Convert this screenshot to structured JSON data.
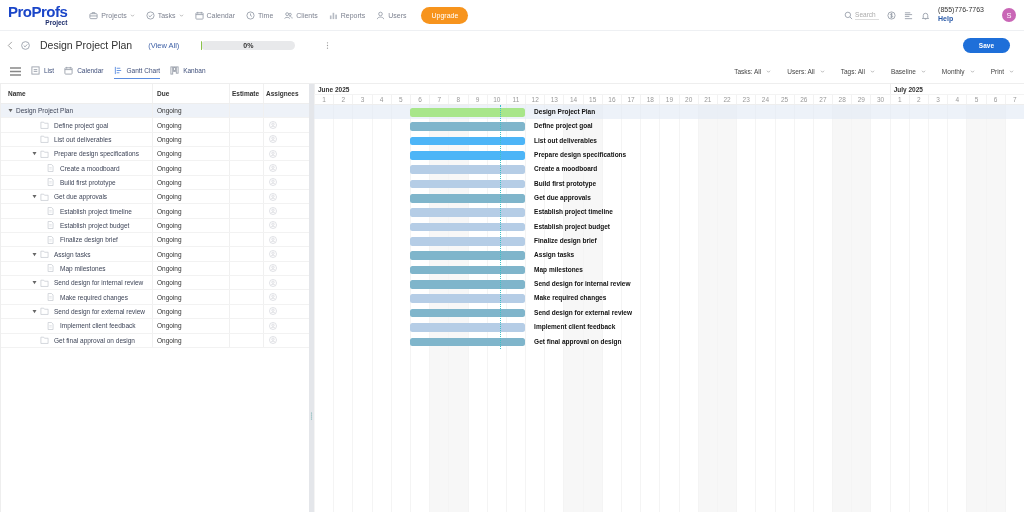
{
  "header": {
    "logo": {
      "brand": "ProProfs",
      "product": "Project"
    },
    "nav": [
      {
        "label": "Projects",
        "dropdown": true
      },
      {
        "label": "Tasks",
        "dropdown": true
      },
      {
        "label": "Calendar",
        "dropdown": false
      },
      {
        "label": "Time",
        "dropdown": false
      },
      {
        "label": "Clients",
        "dropdown": false
      },
      {
        "label": "Reports",
        "dropdown": false
      },
      {
        "label": "Users",
        "dropdown": false
      }
    ],
    "upgrade": "Upgrade",
    "search": {
      "placeholder": "Search"
    },
    "phone": "(855)776-7763",
    "help": "Help",
    "avatar": "S"
  },
  "project": {
    "title": "Design Project Plan",
    "view_all": "(View All)",
    "progress": {
      "level": 0,
      "reading": "0%"
    },
    "save": "Save"
  },
  "views": [
    {
      "label": "List",
      "selected": false
    },
    {
      "label": "Calendar",
      "selected": false
    },
    {
      "label": "Gantt Chart",
      "selected": true
    },
    {
      "label": "Kanban",
      "selected": false
    }
  ],
  "filters": [
    "Tasks: All",
    "Users: All",
    "Tags: All",
    "Baseline",
    "Monthly",
    "Print"
  ],
  "table": {
    "columns": [
      "Name",
      "Due",
      "Estimate",
      "Assignees"
    ],
    "rows": [
      {
        "name": "Design Project Plan",
        "kind": "project",
        "due": "Ongoing",
        "expanded": true,
        "children": [
          {
            "name": "Define project goal",
            "kind": "folder",
            "due": "Ongoing"
          },
          {
            "name": "List out deliverables",
            "kind": "folder",
            "due": "Ongoing"
          },
          {
            "name": "Prepare design specifications",
            "kind": "folder",
            "due": "Ongoing",
            "expanded": true,
            "children": [
              {
                "name": "Create a moodboard",
                "kind": "task",
                "due": "Ongoing"
              },
              {
                "name": "Build first prototype",
                "kind": "task",
                "due": "Ongoing"
              }
            ]
          },
          {
            "name": "Get due approvals",
            "kind": "folder",
            "due": "Ongoing",
            "expanded": true,
            "children": [
              {
                "name": "Establish project timeline",
                "kind": "task",
                "due": "Ongoing"
              },
              {
                "name": "Establish project budget",
                "kind": "task",
                "due": "Ongoing"
              },
              {
                "name": "Finalize design brief",
                "kind": "task",
                "due": "Ongoing"
              }
            ]
          },
          {
            "name": "Assign tasks",
            "kind": "folder",
            "due": "Ongoing",
            "expanded": true,
            "children": [
              {
                "name": "Map milestones",
                "kind": "task",
                "due": "Ongoing"
              }
            ]
          },
          {
            "name": "Send design for internal review",
            "kind": "folder",
            "due": "Ongoing",
            "expanded": true,
            "children": [
              {
                "name": "Make required changes",
                "kind": "task",
                "due": "Ongoing"
              }
            ]
          },
          {
            "name": "Send design for external review",
            "kind": "folder",
            "due": "Ongoing",
            "expanded": true,
            "children": [
              {
                "name": "Implement client feedback",
                "kind": "task",
                "due": "Ongoing"
              }
            ]
          },
          {
            "name": "Get final approval on design",
            "kind": "folder",
            "due": "Ongoing"
          }
        ]
      }
    ]
  },
  "gantt": {
    "months": [
      {
        "label": "June 2025",
        "days": [
          {
            "label": "1",
            "weekend": false
          },
          {
            "label": "2",
            "weekend": false
          },
          {
            "label": "3",
            "weekend": false
          },
          {
            "label": "4",
            "weekend": false
          },
          {
            "label": "5",
            "weekend": false
          },
          {
            "label": "6",
            "weekend": false
          },
          {
            "label": "7",
            "weekend": true
          },
          {
            "label": "8",
            "weekend": true
          },
          {
            "label": "9",
            "weekend": false
          },
          {
            "label": "10",
            "weekend": false
          },
          {
            "label": "11",
            "weekend": false
          },
          {
            "label": "12",
            "weekend": false
          },
          {
            "label": "13",
            "weekend": false
          },
          {
            "label": "14",
            "weekend": true
          },
          {
            "label": "15",
            "weekend": true
          },
          {
            "label": "16",
            "weekend": false
          },
          {
            "label": "17",
            "weekend": false
          },
          {
            "label": "18",
            "weekend": false
          },
          {
            "label": "19",
            "weekend": false
          },
          {
            "label": "20",
            "weekend": false
          },
          {
            "label": "21",
            "weekend": true
          },
          {
            "label": "22",
            "weekend": true
          },
          {
            "label": "23",
            "weekend": false
          },
          {
            "label": "24",
            "weekend": false
          },
          {
            "label": "25",
            "weekend": false
          },
          {
            "label": "26",
            "weekend": false
          },
          {
            "label": "27",
            "weekend": false
          },
          {
            "label": "28",
            "weekend": true
          },
          {
            "label": "29",
            "weekend": true
          },
          {
            "label": "30",
            "weekend": false
          }
        ]
      },
      {
        "label": "July 2025",
        "days": [
          {
            "label": "1",
            "weekend": false
          },
          {
            "label": "2",
            "weekend": false
          },
          {
            "label": "3",
            "weekend": false
          },
          {
            "label": "4",
            "weekend": false
          },
          {
            "label": "5",
            "weekend": true
          },
          {
            "label": "6",
            "weekend": true
          },
          {
            "label": "7",
            "weekend": false
          }
        ]
      }
    ],
    "bars": [
      {
        "label": "Design Project Plan",
        "color": "#a8e68a"
      },
      {
        "label": "Define project goal",
        "color": "#7fb5cb"
      },
      {
        "label": "List out deliverables",
        "color": "#4db5f7"
      },
      {
        "label": "Prepare design specifications",
        "color": "#4db5f7"
      },
      {
        "label": "Create a moodboard",
        "color": "#b5cde6"
      },
      {
        "label": "Build first prototype",
        "color": "#b5cde6"
      },
      {
        "label": "Get due approvals",
        "color": "#7fb5cb"
      },
      {
        "label": "Establish project timeline",
        "color": "#b5cde6"
      },
      {
        "label": "Establish project budget",
        "color": "#b5cde6"
      },
      {
        "label": "Finalize design brief",
        "color": "#b5cde6"
      },
      {
        "label": "Assign tasks",
        "color": "#7fb5cb"
      },
      {
        "label": "Map milestones",
        "color": "#7fb5cb"
      },
      {
        "label": "Send design for internal review",
        "color": "#7fb5cb"
      },
      {
        "label": "Make required changes",
        "color": "#b5cde6"
      },
      {
        "label": "Send design for external review",
        "color": "#7fb5cb"
      },
      {
        "label": "Implement client feedback",
        "color": "#b5cde6"
      },
      {
        "label": "Get final approval on design",
        "color": "#7fb5cb"
      }
    ]
  }
}
